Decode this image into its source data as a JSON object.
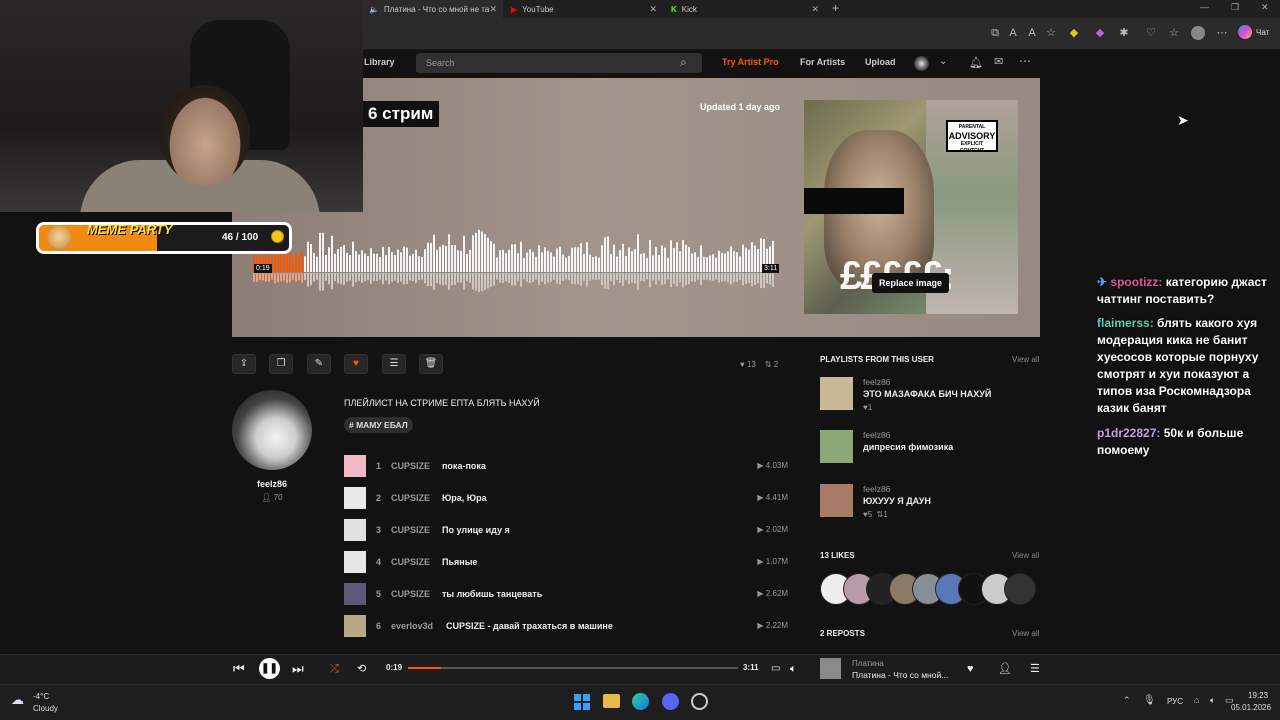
{
  "browser": {
    "tabs": [
      {
        "label": "Платина - Что со мной не та",
        "icon": "speaker-icon"
      },
      {
        "label": "YouTube",
        "icon": "youtube-icon"
      },
      {
        "label": "Kick",
        "icon": "kick-icon"
      }
    ],
    "chat_label": "Чат"
  },
  "header": {
    "library": "Library",
    "search_placeholder": "Search",
    "try_artist_pro": "Try Artist Pro",
    "for_artists": "For Artists",
    "upload": "Upload"
  },
  "hero": {
    "title": "6 стрим",
    "updated": "Updated 1 day ago",
    "replace_image": "Replace image",
    "advisory_top": "PARENTAL",
    "advisory_mid": "ADVISORY",
    "advisory_bottom": "EXPLICIT CONTENT",
    "pounds": "£££££:",
    "time_current": "0:19",
    "time_total": "3:11",
    "progress": 0.099
  },
  "actions": {
    "likes": "13",
    "reposts": "2"
  },
  "uploader": {
    "name": "feelz86",
    "followers": "70"
  },
  "playlist": {
    "description": "ПЛЕЙЛИСТ НА СТРИМЕ ЕПТА БЛЯТЬ НАХУЙ",
    "tag": "# МАМУ ЕБАЛ",
    "tracks": [
      {
        "num": "1",
        "artist": "CUPSIZE",
        "title": "пока-пока",
        "plays": "4.03M",
        "color": "#f2b8c6"
      },
      {
        "num": "2",
        "artist": "CUPSIZE",
        "title": "Юра, Юра",
        "plays": "4.41M",
        "color": "#e8e8e8"
      },
      {
        "num": "3",
        "artist": "CUPSIZE",
        "title": "По улице иду я",
        "plays": "2.02M",
        "color": "#e0e0e0"
      },
      {
        "num": "4",
        "artist": "CUPSIZE",
        "title": "Пьяные",
        "plays": "1.07M",
        "color": "#e6e6e6"
      },
      {
        "num": "5",
        "artist": "CUPSIZE",
        "title": "ты любишь танцевать",
        "plays": "2.62M",
        "color": "#5a5a78"
      },
      {
        "num": "6",
        "artist": "everlov3d",
        "title": "CUPSIZE - давай трахаться в машине",
        "plays": "2.22M",
        "color": "#b8a888"
      }
    ]
  },
  "sidebar": {
    "playlists_head": "PLAYLISTS FROM THIS USER",
    "view_all": "View all",
    "playlists": [
      {
        "user": "feelz86",
        "title": "ЭТО МАЗАФАКА БИЧ НАХУЙ",
        "likes": "1",
        "reposts": "",
        "color": "#c8b898"
      },
      {
        "user": "feelz86",
        "title": "дипресия фимозика",
        "likes": "",
        "reposts": "",
        "color": "#8aa878"
      },
      {
        "user": "feelz86",
        "title": "ЮХУУУ Я ДАУН",
        "likes": "5",
        "reposts": "1",
        "color": "#a87a68"
      }
    ],
    "likes_head": "13 LIKES",
    "reposts_head": "2 REPOSTS"
  },
  "player": {
    "current": "0:19",
    "total": "3:11",
    "artist": "Платина",
    "title": "Платина - Что со мной...",
    "progress": 0.099
  },
  "taskbar": {
    "temp": "-4°C",
    "weather": "Cloudy",
    "lang": "РУС",
    "time": "19:23",
    "date": "05.01.2026"
  },
  "meme": {
    "label": "MEME PARTY",
    "count": "46 / 100"
  },
  "chat": [
    {
      "user": "spootizz:",
      "color": "#e0559a",
      "text": "категорию джаст чаттинг поставить?"
    },
    {
      "user": "flaimerss:",
      "color": "#5ad1b8",
      "text": "блять какого хуя модерация кика не банит хуесосов которые порнуху смотрят и хуи показуют а типов иза Роскомнадзора казик банят"
    },
    {
      "user": "p1dr22827:",
      "color": "#c9a0e8",
      "text": "50к и больше помоему"
    }
  ]
}
